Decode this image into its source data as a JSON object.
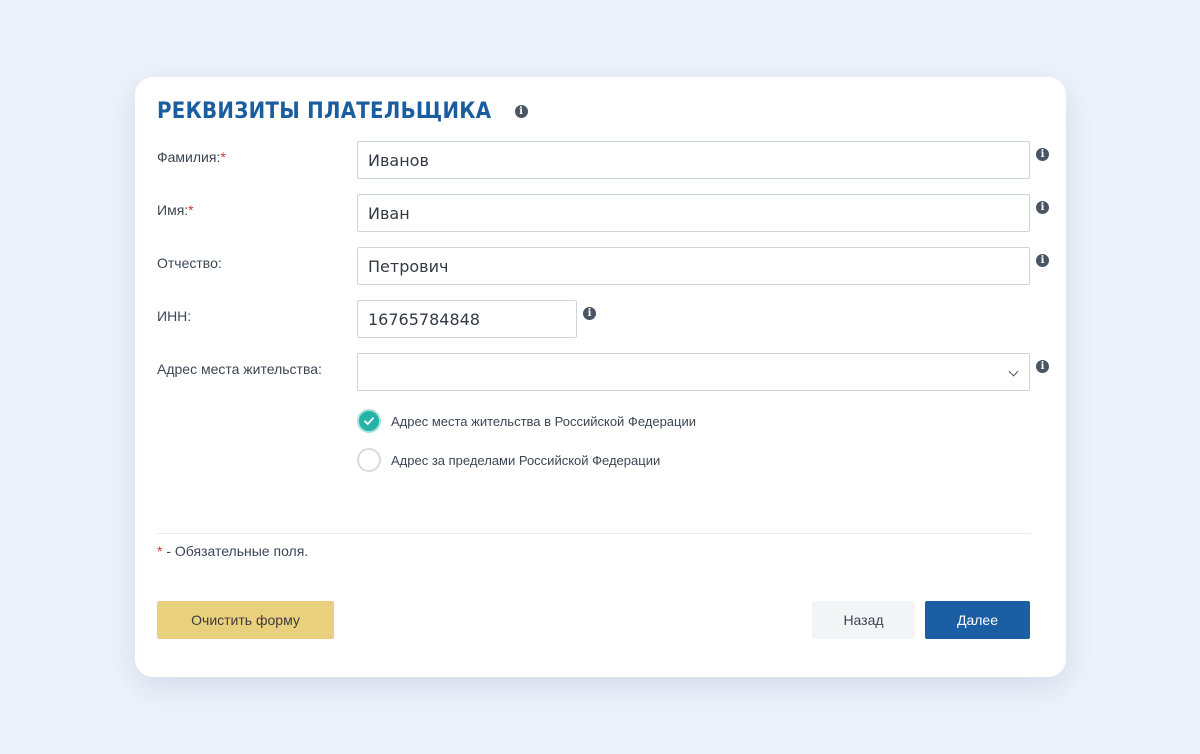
{
  "form": {
    "title": "РЕКВИЗИТЫ ПЛАТЕЛЬЩИКА",
    "fields": {
      "surname": {
        "label": "Фамилия:",
        "required_mark": "*",
        "value": "Иванов"
      },
      "name": {
        "label": "Имя:",
        "required_mark": "*",
        "value": "Иван"
      },
      "patronymic": {
        "label": "Отчество:",
        "value": "Петрович"
      },
      "inn": {
        "label": "ИНН:",
        "value": "16765784848"
      },
      "address": {
        "label": "Адрес места жительства:",
        "value": ""
      }
    },
    "address_type": {
      "options": [
        {
          "label": "Адрес места жительства в Российской Федерации",
          "checked": true
        },
        {
          "label": "Адрес за пределами Российской Федерации",
          "checked": false
        }
      ]
    },
    "required_note": {
      "mark": "*",
      "text": " - Обязательные поля."
    },
    "buttons": {
      "clear": "Очистить форму",
      "back": "Назад",
      "next": "Далее"
    },
    "info_glyph": "i"
  },
  "colors": {
    "page_background": "#edf2fa",
    "title": "#1b5e9f",
    "required": "#d9342b",
    "radio_checked": "#26b3a7",
    "clear_button": "#e9d07d",
    "next_button": "#1b5ea3"
  }
}
